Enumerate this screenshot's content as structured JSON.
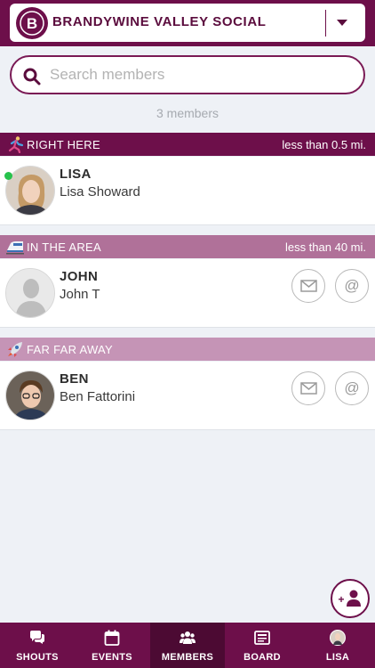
{
  "colors": {
    "brand": "#6d0f4a",
    "brand_dark": "#4c0a33",
    "online": "#27c24c"
  },
  "group": {
    "name": "BRANDYWINE VALLEY SOCIAL",
    "logo_icon": "b-logo-icon",
    "dropdown_icon": "chevron-down-icon"
  },
  "search": {
    "placeholder": "Search members",
    "value": "",
    "icon": "search-icon"
  },
  "member_count": "3 members",
  "sections": [
    {
      "label": "RIGHT HERE",
      "distance": "less than 0.5 mi.",
      "icon": "runner-icon",
      "color": "#6d0f4a",
      "members": [
        {
          "first": "LISA",
          "full": "Lisa Showard",
          "online": true
        }
      ]
    },
    {
      "label": "IN THE AREA",
      "distance": "less than 40 mi.",
      "icon": "train-icon",
      "color": "#b07199",
      "members": [
        {
          "first": "JOHN",
          "full": "John T",
          "online": false
        }
      ]
    },
    {
      "label": "FAR FAR AWAY",
      "distance": "",
      "icon": "rocket-icon",
      "color": "#c594b6",
      "members": [
        {
          "first": "BEN",
          "full": "Ben Fattorini",
          "online": false
        }
      ]
    }
  ],
  "fab": {
    "icon": "add-member-icon"
  },
  "nav": [
    {
      "label": "SHOUTS",
      "icon": "chat-icon",
      "active": false
    },
    {
      "label": "EVENTS",
      "icon": "calendar-icon",
      "active": false
    },
    {
      "label": "MEMBERS",
      "icon": "people-icon",
      "active": true
    },
    {
      "label": "BOARD",
      "icon": "board-icon",
      "active": false
    },
    {
      "label": "LISA",
      "icon": "profile-avatar-icon",
      "active": false
    }
  ]
}
